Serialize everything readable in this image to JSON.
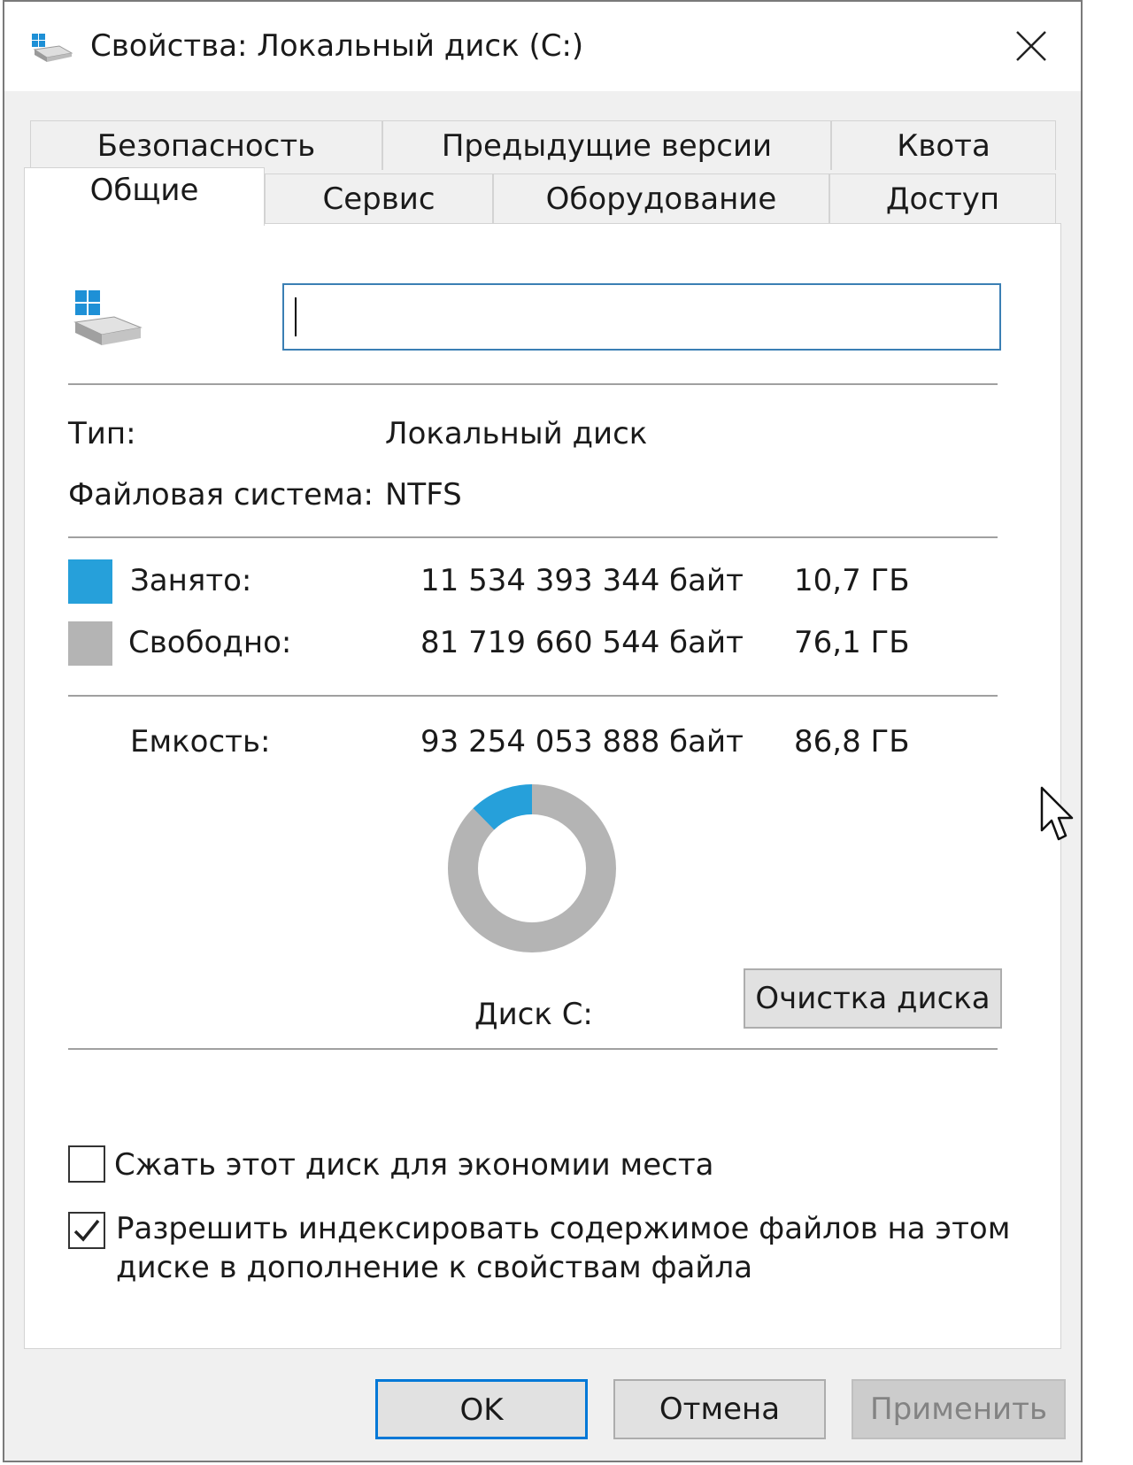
{
  "window": {
    "title": "Свойства: Локальный диск (C:)"
  },
  "tabs_row1": [
    {
      "label": "Безопасность"
    },
    {
      "label": "Предыдущие версии"
    },
    {
      "label": "Квота"
    }
  ],
  "tabs_row2": [
    {
      "label": "Общие",
      "active": true
    },
    {
      "label": "Сервис"
    },
    {
      "label": "Оборудование"
    },
    {
      "label": "Доступ"
    }
  ],
  "general": {
    "name_value": "",
    "type_label": "Тип:",
    "type_value": "Локальный диск",
    "fs_label": "Файловая система:",
    "fs_value": "NTFS",
    "used": {
      "label": "Занято:",
      "bytes": "11 534 393 344 байт",
      "size": "10,7 ГБ",
      "color": "#26a0da"
    },
    "free": {
      "label": "Свободно:",
      "bytes": "81 719 660 544 байт",
      "size": "76,1 ГБ",
      "color": "#b4b4b4"
    },
    "capacity": {
      "label": "Емкость:",
      "bytes": "93 254 053 888 байт",
      "size": "86,8 ГБ"
    },
    "drive_caption": "Диск C:",
    "cleanup_button": "Очистка диска",
    "compress_checkbox": {
      "label": "Сжать этот диск для экономии места",
      "checked": false
    },
    "index_checkbox": {
      "label_line1": "Разрешить индексировать содержимое файлов на этом",
      "label_line2": "диске в дополнение к свойствам файла",
      "checked": true
    }
  },
  "chart_data": {
    "type": "pie",
    "categories": [
      "Занято",
      "Свободно"
    ],
    "values": [
      11534393344,
      81719660544
    ],
    "colors": [
      "#26a0da",
      "#b4b4b4"
    ]
  },
  "footer": {
    "ok": "OK",
    "cancel": "Отмена",
    "apply": "Применить"
  },
  "icons": {
    "title": "drive-icon",
    "close": "close-icon",
    "cursor": "mouse-cursor-icon"
  }
}
